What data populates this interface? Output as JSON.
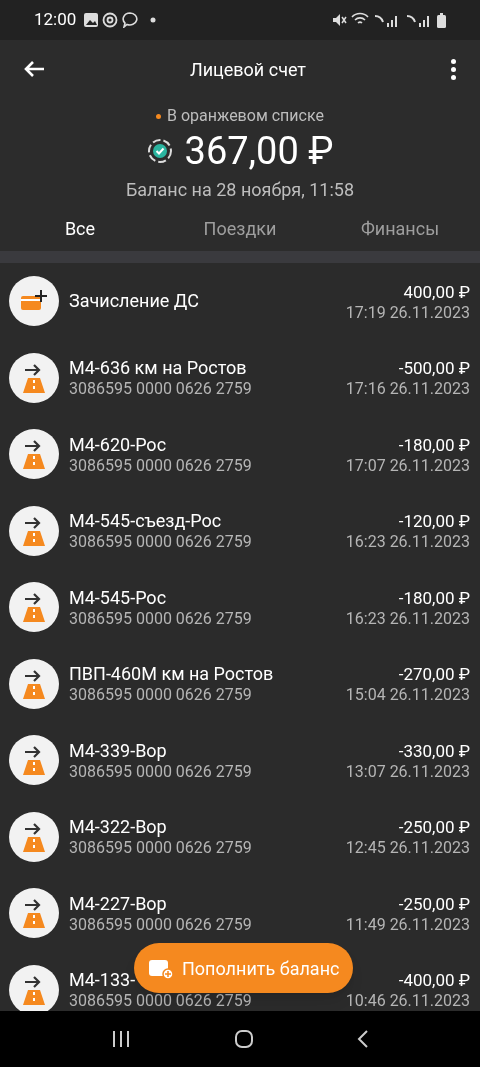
{
  "status_bar": {
    "time": "12:00"
  },
  "header": {
    "title": "Лицевой счет"
  },
  "account": {
    "status": "В оранжевом списке",
    "balance": "367,00 ₽",
    "balance_date": "Баланс на 28 ноября, 11:58"
  },
  "tabs": [
    {
      "label": "Все",
      "selected": true
    },
    {
      "label": "Поездки",
      "selected": false
    },
    {
      "label": "Финансы",
      "selected": false
    }
  ],
  "transactions": [
    {
      "kind": "deposit",
      "title": "Зачисление ДС",
      "amount": "400,00 ₽",
      "time": "17:19 26.11.2023"
    },
    {
      "kind": "toll",
      "title": "М4-636 км на Ростов",
      "card": "3086595 0000 0626 2759",
      "amount": "-500,00 ₽",
      "time": "17:16 26.11.2023"
    },
    {
      "kind": "toll",
      "title": "М4-620-Рос",
      "card": "3086595 0000 0626 2759",
      "amount": "-180,00 ₽",
      "time": "17:07 26.11.2023"
    },
    {
      "kind": "toll",
      "title": "М4-545-съезд-Рос",
      "card": "3086595 0000 0626 2759",
      "amount": "-120,00 ₽",
      "time": "16:23 26.11.2023"
    },
    {
      "kind": "toll",
      "title": "М4-545-Рос",
      "card": "3086595 0000 0626 2759",
      "amount": "-180,00 ₽",
      "time": "16:23 26.11.2023"
    },
    {
      "kind": "toll",
      "title": "ПВП-460М км на Ростов",
      "card": "3086595 0000 0626 2759",
      "amount": "-270,00 ₽",
      "time": "15:04 26.11.2023"
    },
    {
      "kind": "toll",
      "title": "М4-339-Вор",
      "card": "3086595 0000 0626 2759",
      "amount": "-330,00 ₽",
      "time": "13:07 26.11.2023"
    },
    {
      "kind": "toll",
      "title": "М4-322-Вор",
      "card": "3086595 0000 0626 2759",
      "amount": "-250,00 ₽",
      "time": "12:45 26.11.2023"
    },
    {
      "kind": "toll",
      "title": "М4-227-Вор",
      "card": "3086595 0000 0626 2759",
      "amount": "-250,00 ₽",
      "time": "11:49 26.11.2023"
    },
    {
      "kind": "toll",
      "title": "М4-133-",
      "card": "3086595 0000 0626 2759",
      "amount": "-400,00 ₽",
      "time": "10:46 26.11.2023"
    }
  ],
  "fab": {
    "label": "Пополнить баланс"
  }
}
